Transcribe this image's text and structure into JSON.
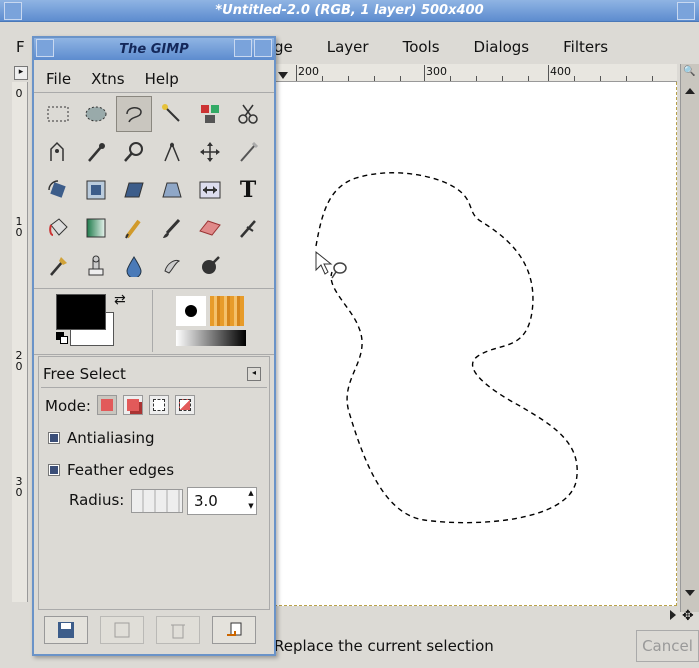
{
  "image_window": {
    "title": "*Untitled-2.0 (RGB, 1 layer) 500x400",
    "menu_visible_first_letter": "F",
    "menu_items": [
      "ge",
      "Layer",
      "Tools",
      "Dialogs",
      "Filters"
    ],
    "ruler_labels": [
      "200",
      "300",
      "400"
    ],
    "vruler_labels": [
      "0",
      "1\n0",
      "2\n0",
      "3\n0"
    ],
    "status_text": "Replace the current selection",
    "cancel_label": "Cancel"
  },
  "toolbox": {
    "title": "The GIMP",
    "menu": [
      "File",
      "Xtns",
      "Help"
    ],
    "tool_icons": [
      "rect-select-icon",
      "ellipse-select-icon",
      "free-select-icon",
      "fuzzy-select-icon",
      "color-select-icon",
      "scissors-icon",
      "paths-icon",
      "color-picker-icon",
      "zoom-icon",
      "measure-icon",
      "move-icon",
      "crop-icon",
      "rotate-icon",
      "scale-icon",
      "shear-icon",
      "perspective-icon",
      "flip-icon",
      "text-icon",
      "bucket-fill-icon",
      "blend-icon",
      "pencil-icon",
      "paintbrush-icon",
      "eraser-icon",
      "airbrush-icon",
      "ink-icon",
      "clone-icon",
      "blur-icon",
      "smudge-icon",
      "dodge-burn-icon"
    ],
    "tool_options": {
      "title": "Free Select",
      "mode_label": "Mode:",
      "antialiasing_label": "Antialiasing",
      "feather_label": "Feather edges",
      "radius_label": "Radius:",
      "radius_value": "3.0"
    },
    "fg_color": "#000000",
    "bg_color": "#ffffff"
  }
}
